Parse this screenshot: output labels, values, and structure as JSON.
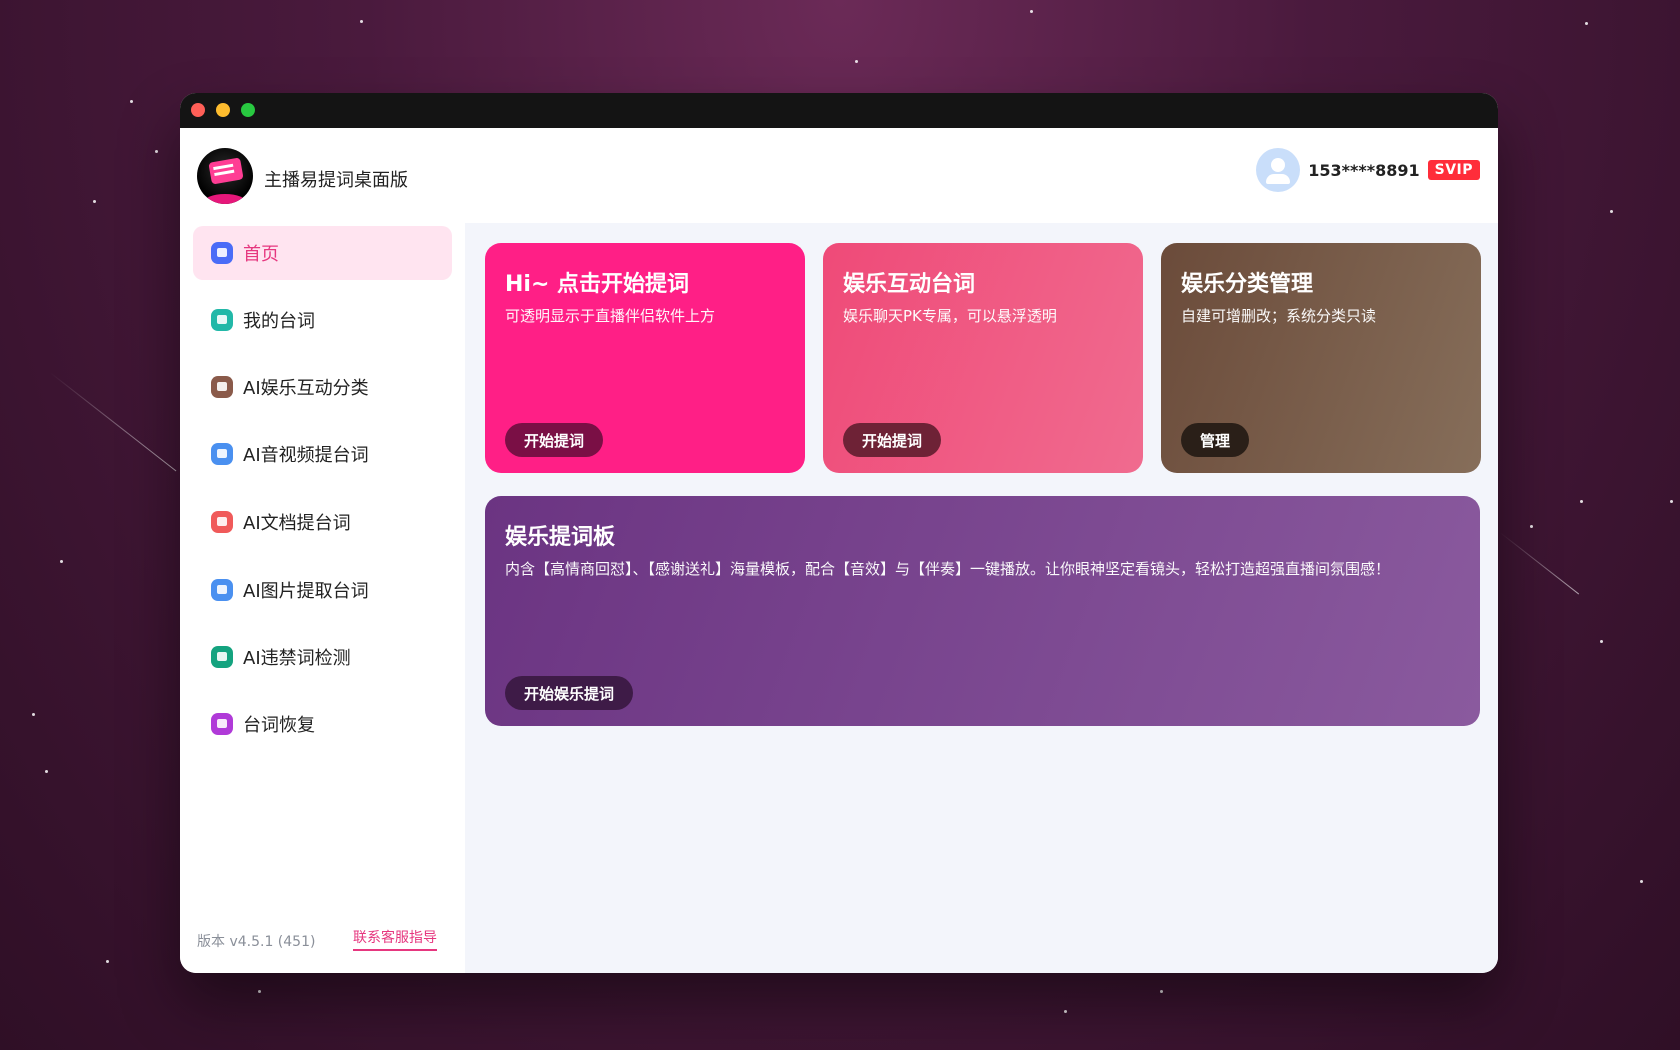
{
  "window": {
    "controls": [
      "close",
      "minimize",
      "maximize"
    ]
  },
  "header": {
    "app_title": "主播易提词桌面版",
    "user_phone": "153****8891",
    "vip_badge": "SVIP"
  },
  "sidebar": {
    "items": [
      {
        "label": "首页",
        "icon": "home-icon",
        "color": "#4a6cf7",
        "active": true
      },
      {
        "label": "我的台词",
        "icon": "script-icon",
        "color": "#22b8a8",
        "active": false
      },
      {
        "label": "AI娱乐互动分类",
        "icon": "list-icon",
        "color": "#8a5a4a",
        "active": false
      },
      {
        "label": "AI音视频提台词",
        "icon": "media-icon",
        "color": "#4a90f0",
        "active": false
      },
      {
        "label": "AI文档提台词",
        "icon": "document-icon",
        "color": "#f05a5a",
        "active": false
      },
      {
        "label": "AI图片提取台词",
        "icon": "image-icon",
        "color": "#4a90f0",
        "active": false
      },
      {
        "label": "AI违禁词检测",
        "icon": "shield-icon",
        "color": "#14a37f",
        "active": false
      },
      {
        "label": "台词恢复",
        "icon": "restore-icon",
        "color": "#b03ad8",
        "active": false
      }
    ],
    "version": "版本 v4.5.1 (451)",
    "support_link": "联系客服指导"
  },
  "cards": [
    {
      "title": "Hi~ 点击开始提词",
      "desc": "可透明显示于直播伴侣软件上方",
      "button": "开始提词"
    },
    {
      "title": "娱乐互动台词",
      "desc": "娱乐聊天PK专属，可以悬浮透明",
      "button": "开始提词"
    },
    {
      "title": "娱乐分类管理",
      "desc": "自建可增删改；系统分类只读",
      "button": "管理"
    },
    {
      "title": "娱乐提词板",
      "desc": "内含【高情商回怼】、【感谢送礼】海量模板，配合【音效】与【伴奏】一键播放。让你眼神坚定看镜头，轻松打造超强直播间氛围感！",
      "button": "开始娱乐提词"
    }
  ],
  "colors": {
    "accent": "#e6377f",
    "active_bg": "#ffe4f0",
    "vip": "#ff2d3a"
  }
}
